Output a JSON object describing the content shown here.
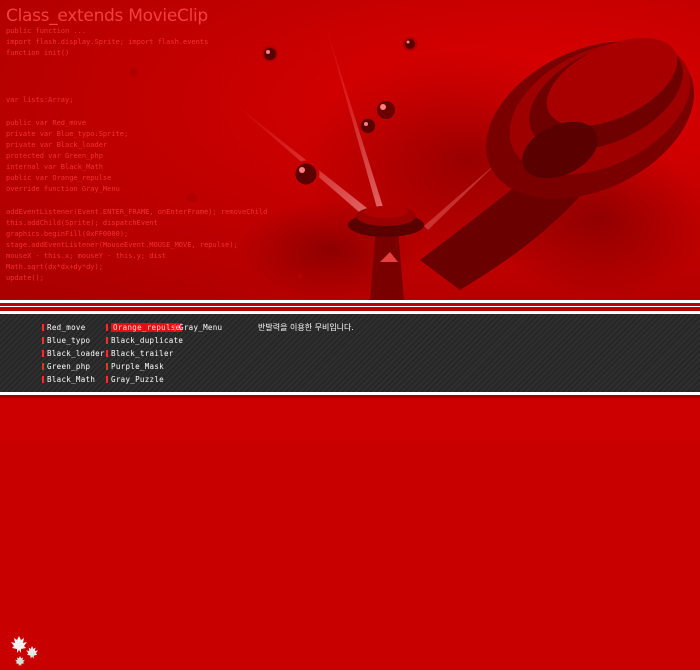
{
  "code_overlay": {
    "title": "Class_extends MovieClip",
    "lines_a": [
      "public function ...",
      "import flash.display.Sprite; import flash.events",
      "function init()"
    ],
    "lines_b": [
      "var lists:Array;"
    ],
    "lines_c": [
      "public var Red_move",
      "private var Blue_typo:Sprite;",
      "private var Black_loader",
      "protected var Green_php",
      "internal var Black_Math",
      "public var Orange_repulse",
      "override function Gray_Menu"
    ],
    "lines_d": [
      "addEventListener(Event.ENTER_FRAME, onEnterFrame); removeChild",
      "this.addChild(Sprite); dispatchEvent",
      "graphics.beginFill(0xFF0000);",
      "stage.addEventListener(MouseEvent.MOUSE_MOVE, repulse);",
      "mouseX - this.x; mouseY - this.y; dist",
      "Math.sqrt(dx*dx+dy*dy);",
      "update();"
    ]
  },
  "menu": {
    "column1": [
      "Red_move",
      "Blue_typo",
      "Black_loader",
      "Green_php",
      "Black_Math"
    ],
    "column2": [
      "Orange_repulse",
      "Black_duplicate",
      "Black_trailer",
      "Purple_Mask",
      "Gray_Puzzle"
    ],
    "column3": [
      "Gray_Menu"
    ],
    "active": "Orange_repulse"
  },
  "description": "반발력을 이용한 무비입니다.",
  "colors": {
    "background": "#c80000",
    "menu_bar": "#2a2a2a",
    "accent": "#e01010",
    "tower": "#7a0000"
  },
  "icons": {
    "logo": "maple-leaf-cluster-icon"
  }
}
